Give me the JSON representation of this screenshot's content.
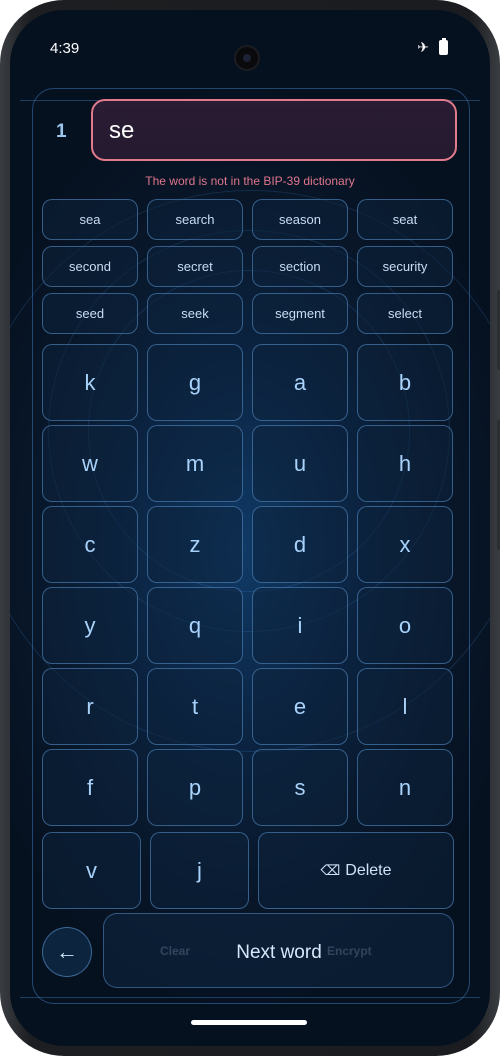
{
  "status_bar": {
    "time": "4:39",
    "icons": [
      "airplane-mode-icon",
      "battery-icon"
    ]
  },
  "entry": {
    "index": "1",
    "value": "se"
  },
  "error_message": "The word is not in the BIP-39 dictionary",
  "suggestions": [
    "sea",
    "search",
    "season",
    "seat",
    "second",
    "secret",
    "section",
    "security",
    "seed",
    "seek",
    "segment",
    "select"
  ],
  "keys": [
    "k",
    "g",
    "a",
    "b",
    "w",
    "m",
    "u",
    "h",
    "c",
    "z",
    "d",
    "x",
    "y",
    "q",
    "i",
    "o",
    "r",
    "t",
    "e",
    "l",
    "f",
    "p",
    "s",
    "n",
    "v",
    "j"
  ],
  "delete_label": "Delete",
  "actions": {
    "back_icon": "arrow-left-icon",
    "clear": "Clear",
    "next_word": "Next word",
    "encrypt": "Encrypt"
  },
  "colors": {
    "accent": "#a8d2fa",
    "error": "#e0768c",
    "input_border": "#e07a8c",
    "background": "#081628"
  }
}
